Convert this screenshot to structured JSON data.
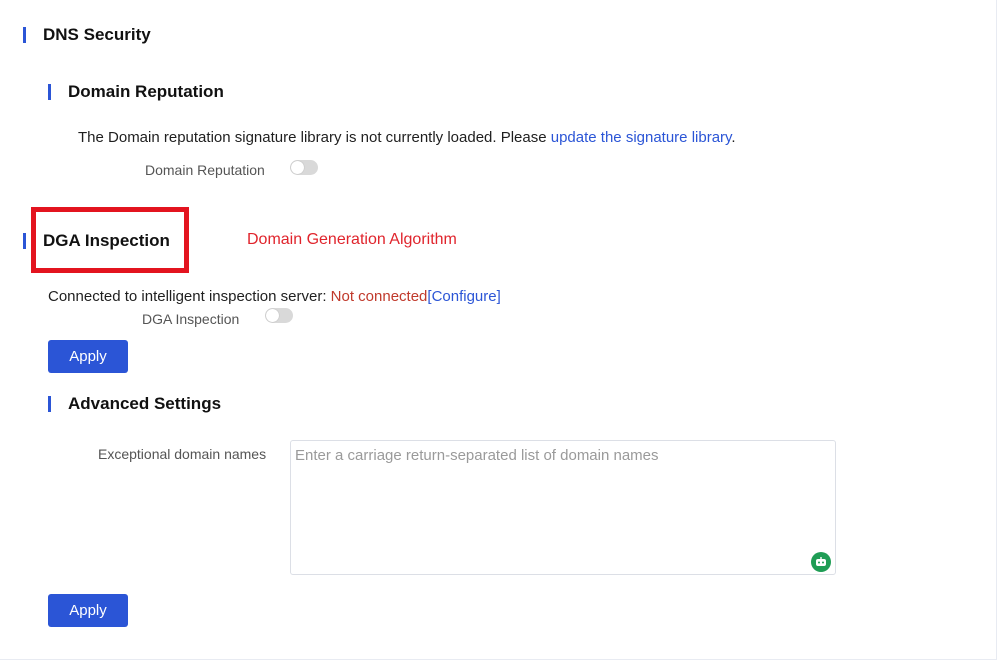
{
  "dns_security": {
    "title": "DNS Security"
  },
  "domain_reputation": {
    "title": "Domain Reputation",
    "notice_prefix": "The Domain reputation signature library is not currently loaded. Please ",
    "notice_link": "update the signature library",
    "notice_suffix": ".",
    "toggle_label": "Domain Reputation",
    "toggle_on": false
  },
  "dga_inspection": {
    "title": "DGA Inspection",
    "annotation": "Domain Generation Algorithm",
    "server_label": "Connected to intelligent inspection server: ",
    "server_status": "Not connected",
    "configure_link": "[Configure]",
    "toggle_label": "DGA Inspection",
    "toggle_on": false,
    "apply_label": "Apply"
  },
  "advanced_settings": {
    "title": "Advanced Settings",
    "exceptional_label": "Exceptional domain names",
    "exceptional_placeholder": "Enter a carriage return-separated list of domain names",
    "exceptional_value": "",
    "apply_label": "Apply"
  },
  "icons": {
    "textarea_assistant": "robot-icon"
  },
  "colors": {
    "accent": "#2b55d6",
    "highlight": "#e3141f",
    "status_error": "#c0392b",
    "assistant_icon": "#1f9d55"
  }
}
